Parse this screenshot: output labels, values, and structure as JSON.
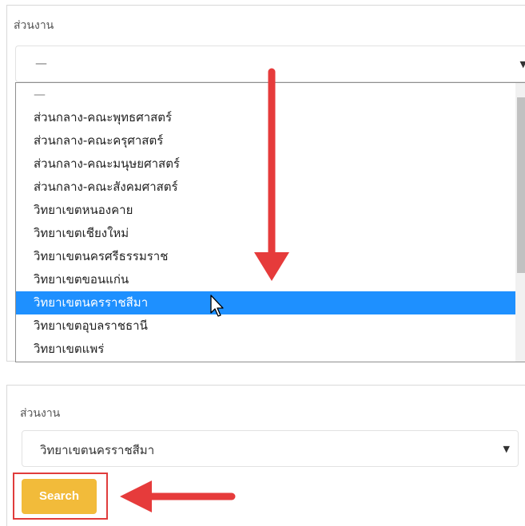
{
  "top_panel": {
    "label": "ส่วนงาน",
    "select_value": "—",
    "caret": "▼",
    "options": [
      "—",
      "ส่วนกลาง-คณะพุทธศาสตร์",
      "ส่วนกลาง-คณะครุศาสตร์",
      "ส่วนกลาง-คณะมนุษยศาสตร์",
      "ส่วนกลาง-คณะสังคมศาสตร์",
      "วิทยาเขตหนองคาย",
      "วิทยาเขตเชียงใหม่",
      "วิทยาเขตนครศรีธรรมราช",
      "วิทยาเขตขอนแก่น",
      "วิทยาเขตนครราชสีมา",
      "วิทยาเขตอุบลราชธานี",
      "วิทยาเขตแพร่"
    ],
    "selected_option": "วิทยาเขตนครราชสีมา"
  },
  "bottom_panel": {
    "label": "ส่วนงาน",
    "select_value": "วิทยาเขตนครราชสีมา",
    "caret": "▼",
    "search_label": "Search"
  },
  "colors": {
    "highlight": "#1e90ff",
    "search_button": "#f2bb3a",
    "annotation_red": "#e63b3b"
  },
  "icons": [
    "mouse-pointer-icon",
    "down-arrow-annotation",
    "left-arrow-annotation",
    "chevron-down-icon"
  ]
}
